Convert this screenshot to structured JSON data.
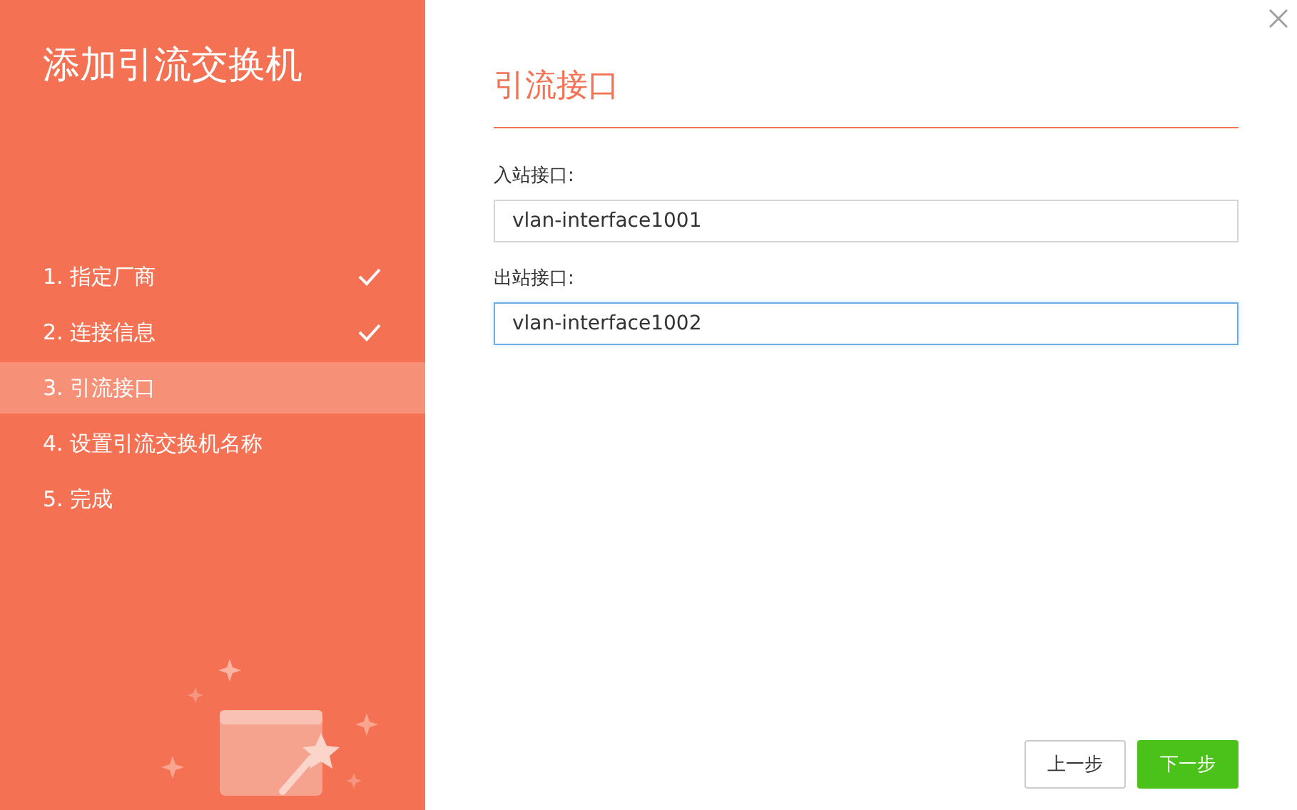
{
  "title": "添加引流交换机",
  "steps": [
    {
      "label": "1. 指定厂商",
      "done": true,
      "selected": false
    },
    {
      "label": "2. 连接信息",
      "done": true,
      "selected": false
    },
    {
      "label": "3. 引流接口",
      "done": false,
      "selected": true
    },
    {
      "label": "4. 设置引流交换机名称",
      "done": false,
      "selected": false
    },
    {
      "label": "5. 完成",
      "done": false,
      "selected": false
    }
  ],
  "section_title": "引流接口",
  "fields": [
    {
      "label": "入站接口:",
      "value": "vlan-interface1001",
      "focused": false
    },
    {
      "label": "出站接口:",
      "value": "vlan-interface1002",
      "focused": true
    }
  ],
  "buttons": [
    {
      "label": "上一步",
      "kind": "secondary"
    },
    {
      "label": "下一步",
      "kind": "primary"
    }
  ]
}
